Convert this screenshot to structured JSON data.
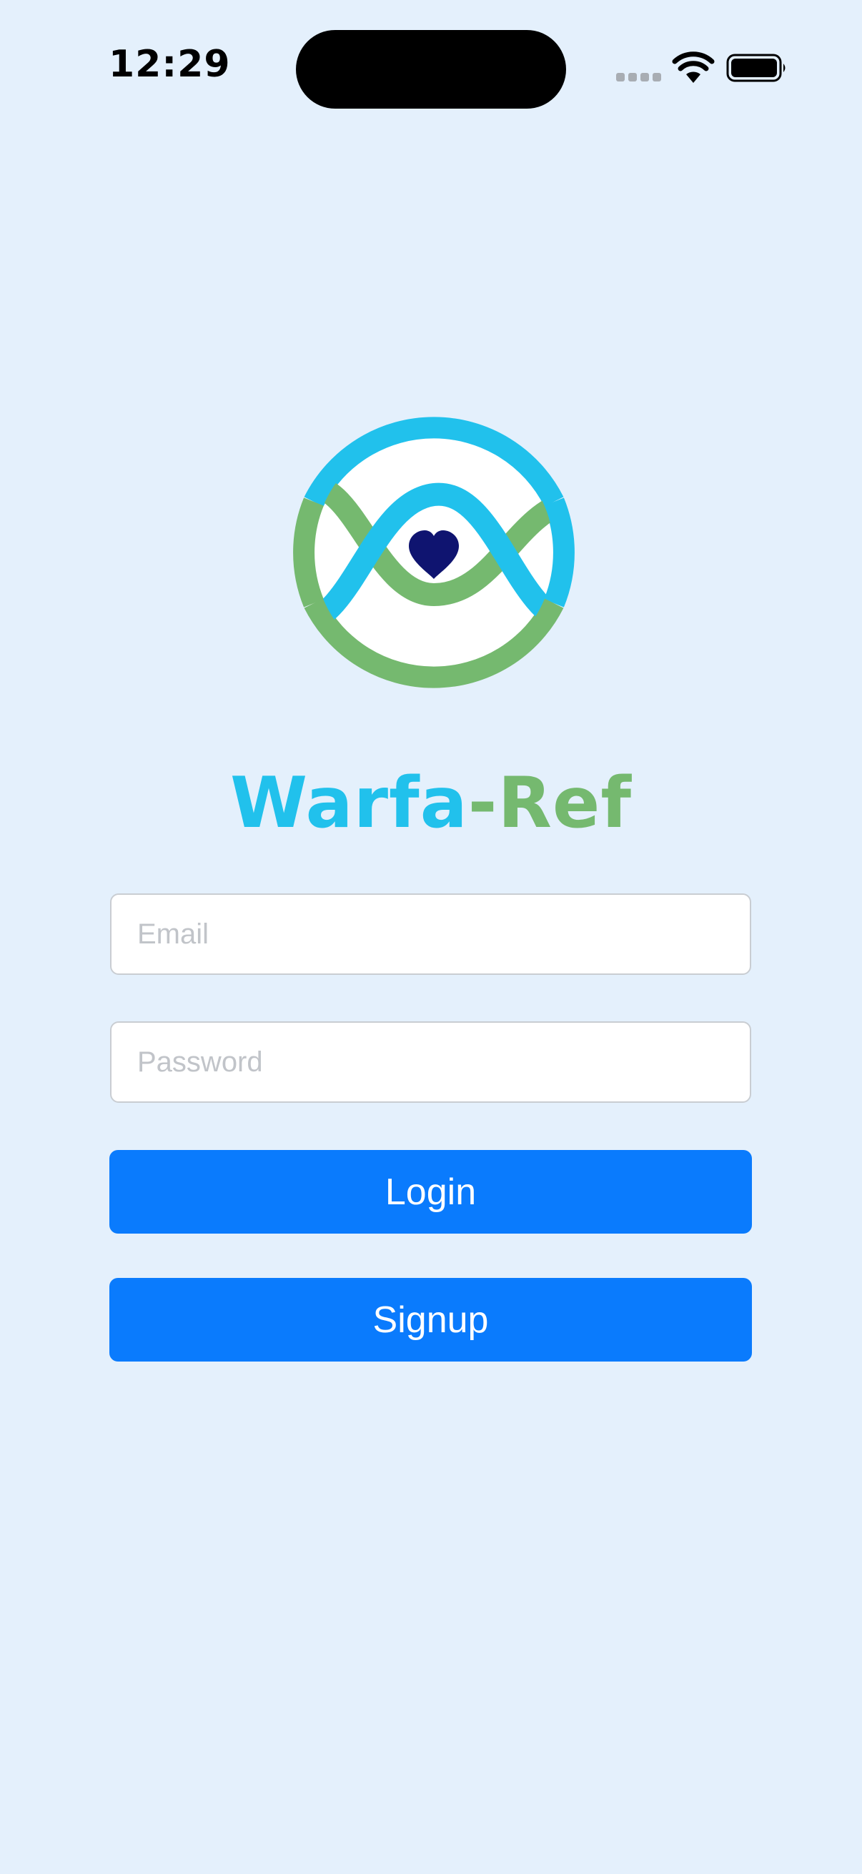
{
  "status_bar": {
    "time": "12:29",
    "signal_icon": "cellular-signal-icon",
    "wifi_icon": "wifi-icon",
    "battery_icon": "battery-icon"
  },
  "logo": {
    "icon": "warfa-ref-logo",
    "colors": {
      "blue": "#21c1ec",
      "green": "#75b96f",
      "heart": "#0f1470"
    }
  },
  "brand": {
    "name_part1": "Warfa",
    "name_part2": "-Ref"
  },
  "form": {
    "email_placeholder": "Email",
    "email_value": "",
    "password_placeholder": "Password",
    "password_value": "",
    "login_label": "Login",
    "signup_label": "Signup"
  },
  "colors": {
    "background": "#e4f0fc",
    "button": "#0a7bfd",
    "button_text": "#ffffff",
    "placeholder": "#c1c4c9"
  }
}
